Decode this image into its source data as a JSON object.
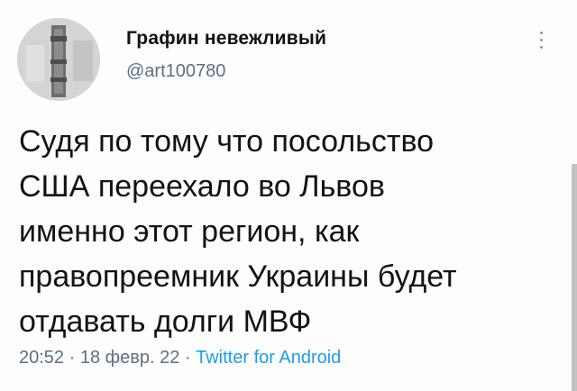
{
  "user": {
    "display_name": "Графин невежливый",
    "handle": "@art100780"
  },
  "icons": {
    "more": "more-vertical-icon"
  },
  "tweet": {
    "lines": [
      "Судя по тому что посольство",
      "США переехало во Львов",
      "именно этот регион, как",
      "правопреемник Украины будет",
      "отдавать долги МВФ"
    ]
  },
  "meta": {
    "time": "20:52",
    "separator": " · ",
    "date": "18 февр. 22",
    "source": "Twitter for Android"
  },
  "colors": {
    "text": "#0f1419",
    "secondary": "#5b7083",
    "link": "#1d9bf0"
  }
}
